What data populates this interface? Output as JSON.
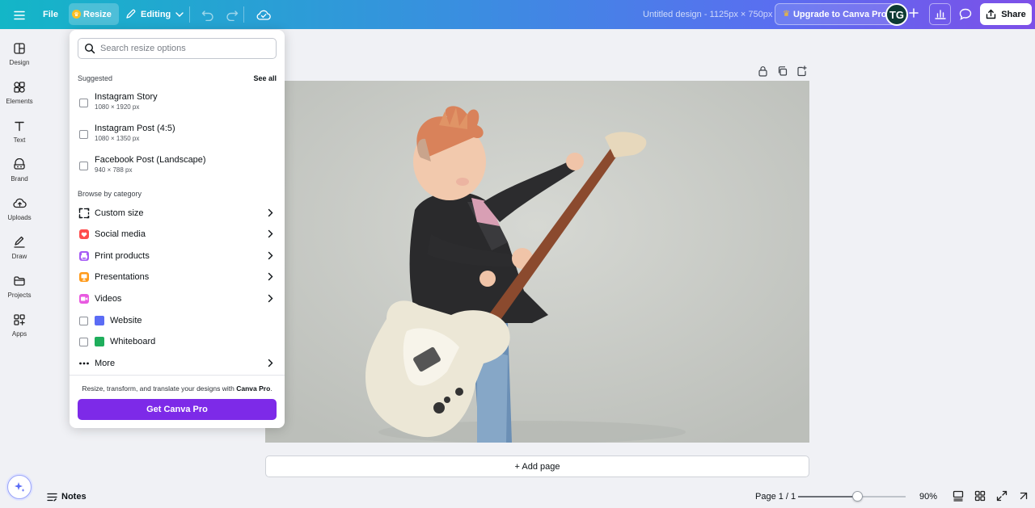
{
  "topbar": {
    "file_label": "File",
    "resize_label": "Resize",
    "editing_label": "Editing",
    "doc_title": "Untitled design - 1125px × 750px",
    "upgrade_label": "Upgrade to Canva Pro",
    "avatar_initials": "TG",
    "share_label": "Share"
  },
  "rail": {
    "items": [
      {
        "label": "Design",
        "icon": "layout-icon"
      },
      {
        "label": "Elements",
        "icon": "shapes-icon"
      },
      {
        "label": "Text",
        "icon": "text-icon"
      },
      {
        "label": "Brand",
        "icon": "brand-icon"
      },
      {
        "label": "Uploads",
        "icon": "cloud-upload-icon"
      },
      {
        "label": "Draw",
        "icon": "pen-icon"
      },
      {
        "label": "Projects",
        "icon": "folder-icon"
      },
      {
        "label": "Apps",
        "icon": "apps-icon"
      }
    ]
  },
  "resize_panel": {
    "search_placeholder": "Search resize options",
    "suggested_label": "Suggested",
    "see_all_label": "See all",
    "suggested": [
      {
        "name": "Instagram Story",
        "size": "1080 × 1920 px"
      },
      {
        "name": "Instagram Post (4:5)",
        "size": "1080 × 1350 px"
      },
      {
        "name": "Facebook Post (Landscape)",
        "size": "940 × 788 px"
      }
    ],
    "browse_label": "Browse by category",
    "categories": [
      {
        "label": "Custom size",
        "icon": "custom-size-icon"
      },
      {
        "label": "Social media",
        "icon": "social-media-icon",
        "color": "#ff4d4d"
      },
      {
        "label": "Print products",
        "icon": "print-icon",
        "color": "#a65cf5"
      },
      {
        "label": "Presentations",
        "icon": "presentation-icon",
        "color": "#ff9a1a"
      },
      {
        "label": "Videos",
        "icon": "video-icon",
        "color": "#e85ae0"
      }
    ],
    "checkbox_items": [
      {
        "label": "Website",
        "color": "#5b6cf5"
      },
      {
        "label": "Whiteboard",
        "color": "#1fae5c"
      }
    ],
    "more_label": "More",
    "promo_prefix": "Resize, transform, and translate your designs with ",
    "promo_brand": "Canva Pro",
    "promo_suffix": ".",
    "cta_label": "Get Canva Pro"
  },
  "canvas": {
    "add_page_label": "+ Add page"
  },
  "bottombar": {
    "notes_label": "Notes",
    "page_indicator": "Page 1 / 1",
    "zoom_label": "90%",
    "zoom_fraction": 0.55
  },
  "colors": {
    "brand_purple": "#7d2ae8",
    "gradient_start": "#13b6c7",
    "gradient_end": "#7d4fe8"
  }
}
